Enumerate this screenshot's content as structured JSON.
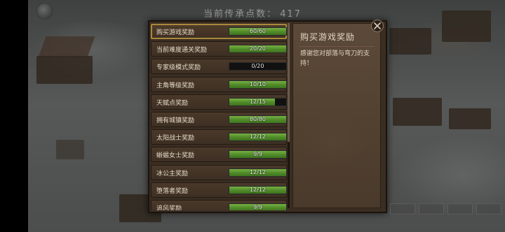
{
  "header": {
    "legacy_points_label": "当前传承点数：",
    "legacy_points_value": "417"
  },
  "rewards": [
    {
      "name": "购买游戏奖励",
      "current": 60,
      "max": 60,
      "count_text": "60/60",
      "selected": true
    },
    {
      "name": "当前难度通关奖励",
      "current": 20,
      "max": 20,
      "count_text": "20/20"
    },
    {
      "name": "专家级模式奖励",
      "current": 0,
      "max": 20,
      "count_text": "0/20"
    },
    {
      "name": "主角等级奖励",
      "current": 10,
      "max": 10,
      "count_text": "10/10"
    },
    {
      "name": "天赋点奖励",
      "current": 12,
      "max": 15,
      "count_text": "12/15"
    },
    {
      "name": "拥有城镇奖励",
      "current": 80,
      "max": 80,
      "count_text": "80/80"
    },
    {
      "name": "太阳战士奖励",
      "current": 12,
      "max": 12,
      "count_text": "12/12"
    },
    {
      "name": "蜥蜴女士奖励",
      "current": 9,
      "max": 9,
      "count_text": "9/9"
    },
    {
      "name": "冰公主奖励",
      "current": 12,
      "max": 12,
      "count_text": "12/12"
    },
    {
      "name": "堕落者奖励",
      "current": 12,
      "max": 12,
      "count_text": "12/12"
    },
    {
      "name": "追风奖励",
      "current": 9,
      "max": 9,
      "count_text": "9/9"
    }
  ],
  "detail": {
    "title": "购买游戏奖励",
    "description": "感谢您对部落与弯刀的支持！"
  },
  "colors": {
    "bar_fill": "#5c9a30",
    "selected_border": "#a98a3b",
    "panel": "#3a2d22"
  }
}
